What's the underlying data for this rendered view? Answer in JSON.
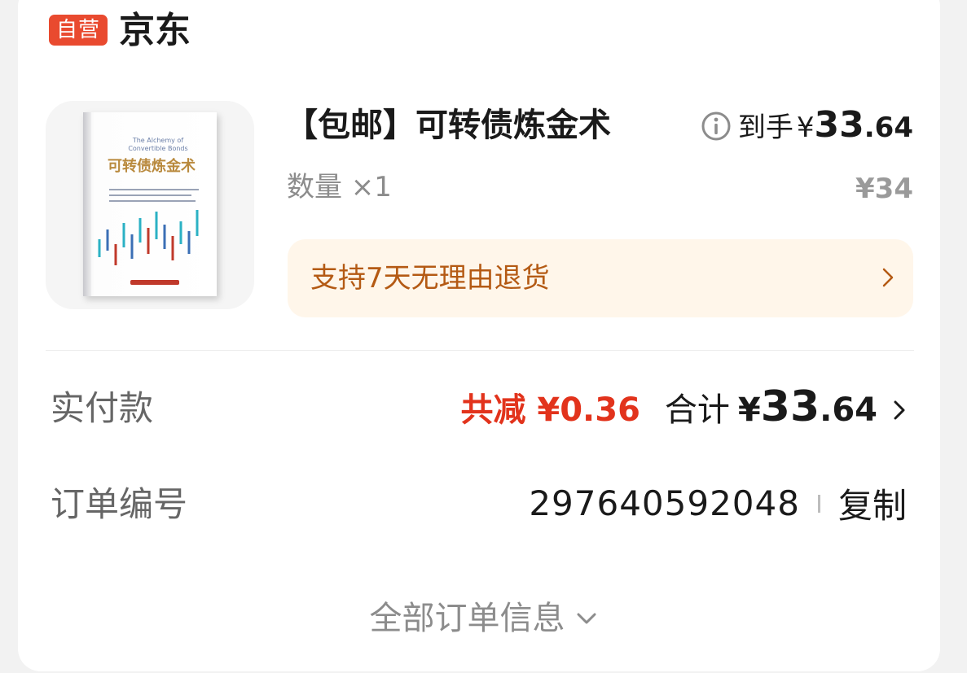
{
  "store": {
    "badge": "自营",
    "name": "京东"
  },
  "product": {
    "title": "【包邮】可转债炼金术",
    "price_label": "到手",
    "currency": "¥",
    "price_int": "33",
    "price_dec": ".64",
    "quantity": "数量 ×1",
    "original_price": "¥34",
    "cover": {
      "en_title_line1": "The Alchemy of",
      "en_title_line2": "Convertible Bonds",
      "cn_title": "可转债炼金术"
    }
  },
  "return_policy": {
    "text": "支持7天无理由退货"
  },
  "payment": {
    "label": "实付款",
    "discount": "共减 ¥0.36",
    "total_label": "合计",
    "total_currency": "¥",
    "total_int": "33",
    "total_dec": ".64"
  },
  "order": {
    "label": "订单编号",
    "number": "297640592048",
    "copy_label": "复制"
  },
  "footer": {
    "all_info_label": "全部订单信息"
  },
  "colors": {
    "badge_bg": "#e94a2f",
    "discount": "#e2331c",
    "return_bar_bg": "#fff6ea",
    "return_text": "#b45a14"
  },
  "icons": {
    "info": "info-circle-icon",
    "chevron_right": "chevron-right-icon",
    "chevron_down": "chevron-down-icon"
  }
}
